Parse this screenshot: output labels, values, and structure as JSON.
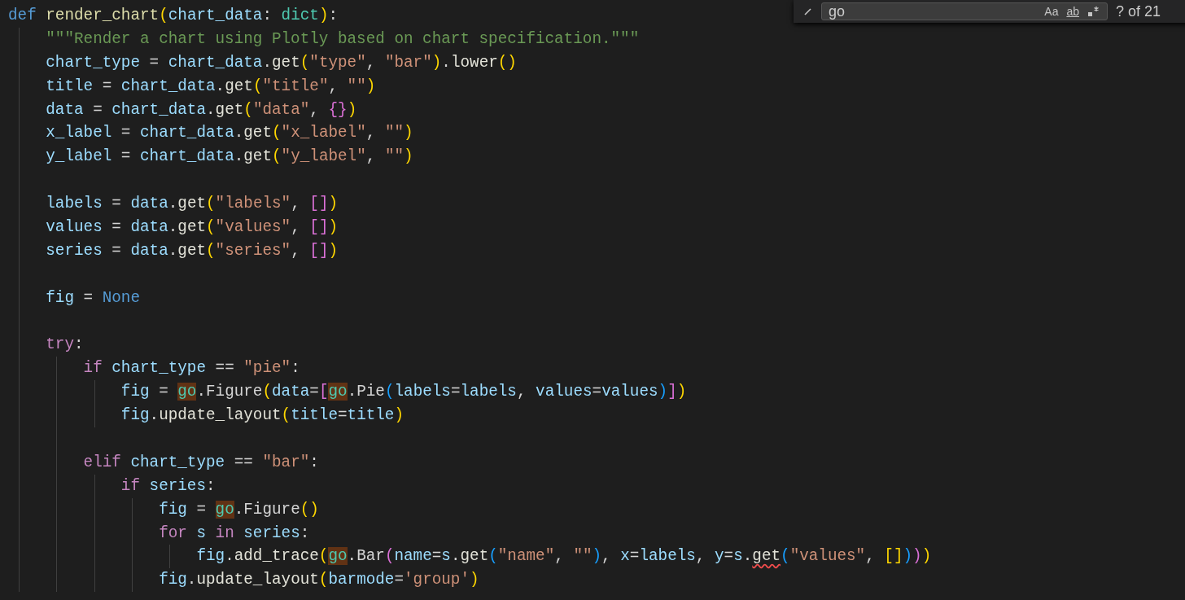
{
  "editor": {
    "lines": [
      {
        "kind": "code",
        "tokens": [
          {
            "kind": "def",
            "text": "def "
          },
          {
            "kind": "fn",
            "text": "render_chart"
          },
          {
            "kind": "b1",
            "text": "("
          },
          {
            "kind": "var",
            "text": "chart_data"
          },
          {
            "kind": "op",
            "text": ": "
          },
          {
            "kind": "type",
            "text": "dict"
          },
          {
            "kind": "b1",
            "text": ")"
          },
          {
            "kind": "op",
            "text": ":"
          }
        ]
      },
      {
        "kind": "code",
        "tokens": [
          {
            "kind": "doc",
            "text": "    \"\"\"Render a chart using Plotly based on chart specification.\"\"\""
          }
        ]
      },
      {
        "kind": "code",
        "tokens": [
          {
            "kind": "var",
            "text": "    chart_type"
          },
          {
            "kind": "op",
            "text": " = "
          },
          {
            "kind": "var",
            "text": "chart_data"
          },
          {
            "kind": "op",
            "text": "."
          },
          {
            "kind": "method",
            "text": "get"
          },
          {
            "kind": "b1",
            "text": "("
          },
          {
            "kind": "str",
            "text": "\"type\""
          },
          {
            "kind": "op",
            "text": ", "
          },
          {
            "kind": "str",
            "text": "\"bar\""
          },
          {
            "kind": "b1",
            "text": ")"
          },
          {
            "kind": "op",
            "text": "."
          },
          {
            "kind": "method",
            "text": "lower"
          },
          {
            "kind": "b1",
            "text": "()"
          }
        ]
      },
      {
        "kind": "code",
        "tokens": [
          {
            "kind": "var",
            "text": "    title"
          },
          {
            "kind": "op",
            "text": " = "
          },
          {
            "kind": "var",
            "text": "chart_data"
          },
          {
            "kind": "op",
            "text": "."
          },
          {
            "kind": "method",
            "text": "get"
          },
          {
            "kind": "b1",
            "text": "("
          },
          {
            "kind": "str",
            "text": "\"title\""
          },
          {
            "kind": "op",
            "text": ", "
          },
          {
            "kind": "str",
            "text": "\"\""
          },
          {
            "kind": "b1",
            "text": ")"
          }
        ]
      },
      {
        "kind": "code",
        "tokens": [
          {
            "kind": "var",
            "text": "    data"
          },
          {
            "kind": "op",
            "text": " = "
          },
          {
            "kind": "var",
            "text": "chart_data"
          },
          {
            "kind": "op",
            "text": "."
          },
          {
            "kind": "method",
            "text": "get"
          },
          {
            "kind": "b1",
            "text": "("
          },
          {
            "kind": "str",
            "text": "\"data\""
          },
          {
            "kind": "op",
            "text": ", "
          },
          {
            "kind": "b2",
            "text": "{}"
          },
          {
            "kind": "b1",
            "text": ")"
          }
        ]
      },
      {
        "kind": "code",
        "tokens": [
          {
            "kind": "var",
            "text": "    x_label"
          },
          {
            "kind": "op",
            "text": " = "
          },
          {
            "kind": "var",
            "text": "chart_data"
          },
          {
            "kind": "op",
            "text": "."
          },
          {
            "kind": "method",
            "text": "get"
          },
          {
            "kind": "b1",
            "text": "("
          },
          {
            "kind": "str",
            "text": "\"x_label\""
          },
          {
            "kind": "op",
            "text": ", "
          },
          {
            "kind": "str",
            "text": "\"\""
          },
          {
            "kind": "b1",
            "text": ")"
          }
        ]
      },
      {
        "kind": "code",
        "tokens": [
          {
            "kind": "var",
            "text": "    y_label"
          },
          {
            "kind": "op",
            "text": " = "
          },
          {
            "kind": "var",
            "text": "chart_data"
          },
          {
            "kind": "op",
            "text": "."
          },
          {
            "kind": "method",
            "text": "get"
          },
          {
            "kind": "b1",
            "text": "("
          },
          {
            "kind": "str",
            "text": "\"y_label\""
          },
          {
            "kind": "op",
            "text": ", "
          },
          {
            "kind": "str",
            "text": "\"\""
          },
          {
            "kind": "b1",
            "text": ")"
          }
        ]
      },
      {
        "kind": "blank"
      },
      {
        "kind": "code",
        "tokens": [
          {
            "kind": "var",
            "text": "    labels"
          },
          {
            "kind": "op",
            "text": " = "
          },
          {
            "kind": "var",
            "text": "data"
          },
          {
            "kind": "op",
            "text": "."
          },
          {
            "kind": "method",
            "text": "get"
          },
          {
            "kind": "b1",
            "text": "("
          },
          {
            "kind": "str",
            "text": "\"labels\""
          },
          {
            "kind": "op",
            "text": ", "
          },
          {
            "kind": "b2",
            "text": "[]"
          },
          {
            "kind": "b1",
            "text": ")"
          }
        ]
      },
      {
        "kind": "code",
        "tokens": [
          {
            "kind": "var",
            "text": "    values"
          },
          {
            "kind": "op",
            "text": " = "
          },
          {
            "kind": "var",
            "text": "data"
          },
          {
            "kind": "op",
            "text": "."
          },
          {
            "kind": "method",
            "text": "get"
          },
          {
            "kind": "b1",
            "text": "("
          },
          {
            "kind": "str",
            "text": "\"values\""
          },
          {
            "kind": "op",
            "text": ", "
          },
          {
            "kind": "b2",
            "text": "[]"
          },
          {
            "kind": "b1",
            "text": ")"
          }
        ]
      },
      {
        "kind": "code",
        "tokens": [
          {
            "kind": "var",
            "text": "    series"
          },
          {
            "kind": "op",
            "text": " = "
          },
          {
            "kind": "var",
            "text": "data"
          },
          {
            "kind": "op",
            "text": "."
          },
          {
            "kind": "method",
            "text": "get"
          },
          {
            "kind": "b1",
            "text": "("
          },
          {
            "kind": "str",
            "text": "\"series\""
          },
          {
            "kind": "op",
            "text": ", "
          },
          {
            "kind": "b2",
            "text": "[]"
          },
          {
            "kind": "b1",
            "text": ")"
          }
        ]
      },
      {
        "kind": "blank"
      },
      {
        "kind": "code",
        "tokens": [
          {
            "kind": "var",
            "text": "    fig"
          },
          {
            "kind": "op",
            "text": " = "
          },
          {
            "kind": "const",
            "text": "None"
          }
        ]
      },
      {
        "kind": "blank"
      },
      {
        "kind": "code",
        "tokens": [
          {
            "kind": "kw",
            "text": "    try"
          },
          {
            "kind": "op",
            "text": ":"
          }
        ]
      },
      {
        "kind": "code",
        "tokens": [
          {
            "kind": "kw",
            "text": "        if "
          },
          {
            "kind": "var",
            "text": "chart_type"
          },
          {
            "kind": "op",
            "text": " == "
          },
          {
            "kind": "str",
            "text": "\"pie\""
          },
          {
            "kind": "op",
            "text": ":"
          }
        ]
      },
      {
        "kind": "code",
        "tokens": [
          {
            "kind": "var",
            "text": "            fig"
          },
          {
            "kind": "op",
            "text": " = "
          },
          {
            "kind": "match",
            "text": "go"
          },
          {
            "kind": "op",
            "text": ".Figure"
          },
          {
            "kind": "b1",
            "text": "("
          },
          {
            "kind": "var",
            "text": "data"
          },
          {
            "kind": "op",
            "text": "="
          },
          {
            "kind": "b2",
            "text": "["
          },
          {
            "kind": "match",
            "text": "go"
          },
          {
            "kind": "op",
            "text": ".Pie"
          },
          {
            "kind": "b3",
            "text": "("
          },
          {
            "kind": "var",
            "text": "labels"
          },
          {
            "kind": "op",
            "text": "="
          },
          {
            "kind": "var",
            "text": "labels"
          },
          {
            "kind": "op",
            "text": ", "
          },
          {
            "kind": "var",
            "text": "values"
          },
          {
            "kind": "op",
            "text": "="
          },
          {
            "kind": "var",
            "text": "values"
          },
          {
            "kind": "b3",
            "text": ")"
          },
          {
            "kind": "b2",
            "text": "]"
          },
          {
            "kind": "b1",
            "text": ")"
          }
        ]
      },
      {
        "kind": "code",
        "tokens": [
          {
            "kind": "var",
            "text": "            fig"
          },
          {
            "kind": "op",
            "text": "."
          },
          {
            "kind": "method",
            "text": "update_layout"
          },
          {
            "kind": "b1",
            "text": "("
          },
          {
            "kind": "var",
            "text": "title"
          },
          {
            "kind": "op",
            "text": "="
          },
          {
            "kind": "var",
            "text": "title"
          },
          {
            "kind": "b1",
            "text": ")"
          }
        ]
      },
      {
        "kind": "blank"
      },
      {
        "kind": "code",
        "tokens": [
          {
            "kind": "kw",
            "text": "        elif "
          },
          {
            "kind": "var",
            "text": "chart_type"
          },
          {
            "kind": "op",
            "text": " == "
          },
          {
            "kind": "str",
            "text": "\"bar\""
          },
          {
            "kind": "op",
            "text": ":"
          }
        ]
      },
      {
        "kind": "code",
        "tokens": [
          {
            "kind": "kw",
            "text": "            if "
          },
          {
            "kind": "var",
            "text": "series"
          },
          {
            "kind": "op",
            "text": ":"
          }
        ]
      },
      {
        "kind": "code",
        "tokens": [
          {
            "kind": "var",
            "text": "                fig"
          },
          {
            "kind": "op",
            "text": " = "
          },
          {
            "kind": "match",
            "text": "go"
          },
          {
            "kind": "op",
            "text": ".Figure"
          },
          {
            "kind": "b1",
            "text": "()"
          }
        ]
      },
      {
        "kind": "code",
        "tokens": [
          {
            "kind": "kw",
            "text": "                for "
          },
          {
            "kind": "var",
            "text": "s "
          },
          {
            "kind": "kw",
            "text": "in "
          },
          {
            "kind": "var",
            "text": "series"
          },
          {
            "kind": "op",
            "text": ":"
          }
        ]
      },
      {
        "kind": "code",
        "tokens": [
          {
            "kind": "var",
            "text": "                    fig"
          },
          {
            "kind": "op",
            "text": "."
          },
          {
            "kind": "method",
            "text": "add_trace"
          },
          {
            "kind": "b1",
            "text": "("
          },
          {
            "kind": "match",
            "text": "go"
          },
          {
            "kind": "op",
            "text": ".Bar"
          },
          {
            "kind": "b2",
            "text": "("
          },
          {
            "kind": "var",
            "text": "name"
          },
          {
            "kind": "op",
            "text": "="
          },
          {
            "kind": "var",
            "text": "s"
          },
          {
            "kind": "op",
            "text": "."
          },
          {
            "kind": "method",
            "text": "get"
          },
          {
            "kind": "b3",
            "text": "("
          },
          {
            "kind": "str",
            "text": "\"name\""
          },
          {
            "kind": "op",
            "text": ", "
          },
          {
            "kind": "str",
            "text": "\"\""
          },
          {
            "kind": "b3",
            "text": ")"
          },
          {
            "kind": "op",
            "text": ", "
          },
          {
            "kind": "var",
            "text": "x"
          },
          {
            "kind": "op",
            "text": "="
          },
          {
            "kind": "var",
            "text": "labels"
          },
          {
            "kind": "op",
            "text": ", "
          },
          {
            "kind": "var",
            "text": "y"
          },
          {
            "kind": "op",
            "text": "="
          },
          {
            "kind": "var",
            "text": "s"
          },
          {
            "kind": "op",
            "text": "."
          },
          {
            "kind": "err",
            "text": "get"
          },
          {
            "kind": "b3",
            "text": "("
          },
          {
            "kind": "str",
            "text": "\"values\""
          },
          {
            "kind": "op",
            "text": ", "
          },
          {
            "kind": "b1",
            "text": "[]"
          },
          {
            "kind": "b3",
            "text": ")"
          },
          {
            "kind": "b2",
            "text": ")"
          },
          {
            "kind": "b1",
            "text": ")"
          }
        ]
      },
      {
        "kind": "code",
        "tokens": [
          {
            "kind": "var",
            "text": "                fig"
          },
          {
            "kind": "op",
            "text": "."
          },
          {
            "kind": "method",
            "text": "update_layout"
          },
          {
            "kind": "b1",
            "text": "("
          },
          {
            "kind": "var",
            "text": "barmode"
          },
          {
            "kind": "op",
            "text": "="
          },
          {
            "kind": "str",
            "text": "'group'"
          },
          {
            "kind": "b1",
            "text": ")"
          }
        ]
      }
    ]
  },
  "find_widget": {
    "query": "go",
    "match_case": "Aa",
    "whole_word": "ab",
    "result": "? of 21"
  }
}
